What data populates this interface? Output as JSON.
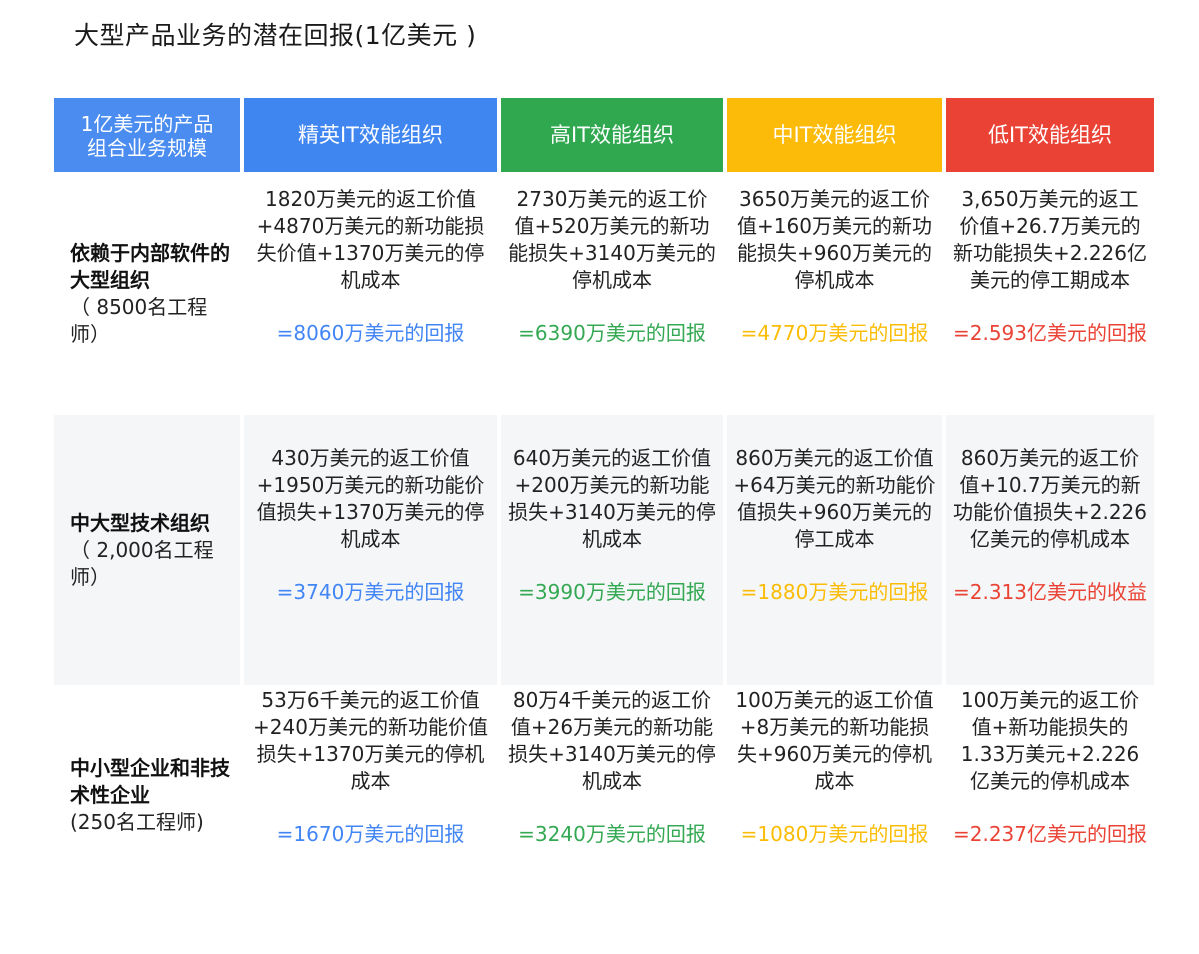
{
  "title": "大型产品业务的潜在回报(1亿美元 )",
  "headers": [
    {
      "label": "1亿美元的产品\n组合业务规模",
      "color": "#4a8cf0"
    },
    {
      "label": "精英IT效能组织",
      "color": "#3f86f1"
    },
    {
      "label": "高IT效能组织",
      "color": "#2fa84f"
    },
    {
      "label": "中IT效能组织",
      "color": "#fbbb08"
    },
    {
      "label": "低IT效能组织",
      "color": "#ea4335"
    }
  ],
  "rows": [
    {
      "title": "依赖于内部软件的大型组织",
      "sub": "（ 8500名工程师）",
      "cells": [
        {
          "desc": "1820万美元的返工价值+4870万美元的新功能损失价值+1370万美元的停机成本",
          "result": "=8060万美元的回报"
        },
        {
          "desc": "2730万美元的返工价值+520万美元的新功能损失+3140万美元的停机成本",
          "result": "=6390万美元的回报"
        },
        {
          "desc": "3650万美元的返工价值+160万美元的新功能损失+960万美元的停机成本",
          "result": "=4770万美元的回报"
        },
        {
          "desc": "3,650万美元的返工价值+26.7万美元的新功能损失+2.226亿美元的停工期成本",
          "result": "=2.593亿美元的回报"
        }
      ]
    },
    {
      "title": "中大型技术组织",
      "sub": "（ 2,000名工程师）",
      "cells": [
        {
          "desc": "430万美元的返工价值+1950万美元的新功能价值损失+1370万美元的停机成本",
          "result": "=3740万美元的回报"
        },
        {
          "desc": "640万美元的返工价值+200万美元的新功能损失+3140万美元的停机成本",
          "result": "=3990万美元的回报"
        },
        {
          "desc": "860万美元的返工价值+64万美元的新功能价值损失+960万美元的停工成本",
          "result": "=1880万美元的回报"
        },
        {
          "desc": "860万美元的返工价值+10.7万美元的新功能价值损失+2.226亿美元的停机成本",
          "result": "=2.313亿美元的收益"
        }
      ]
    },
    {
      "title": "中小型企业和非技术性企业",
      "sub": "(250名工程师)",
      "cells": [
        {
          "desc": "53万6千美元的返工价值+240万美元的新功能价值损失+1370万美元的停机成本",
          "result": "=1670万美元的回报"
        },
        {
          "desc": "80万4千美元的返工价值+26万美元的新功能损失+3140万美元的停机成本",
          "result": "=3240万美元的回报"
        },
        {
          "desc": "100万美元的返工价值+8万美元的新功能损失+960万美元的停机成本",
          "result": "=1080万美元的回报"
        },
        {
          "desc": "100万美元的返工价值+新功能损失的1.33万美元+2.226亿美元的停机成本",
          "result": "=2.237亿美元的回报"
        }
      ]
    }
  ],
  "result_colors": [
    "#4285f4",
    "#34a853",
    "#fbbc05",
    "#ea4335"
  ]
}
